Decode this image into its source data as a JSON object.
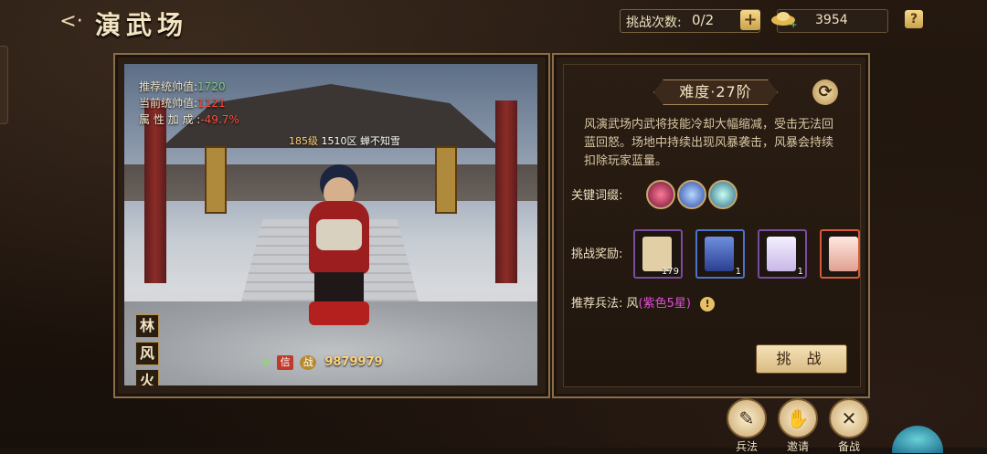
{
  "header": {
    "title": "演武场",
    "challenge_label": "挑战次数:",
    "challenge_count": "0/2",
    "gold": "3954",
    "help": "?"
  },
  "hero": {
    "recommended_label": "推荐统帅值:",
    "recommended_value": "1720",
    "current_label": "当前统帅值:",
    "current_value": "1121",
    "bonus_label": "属 性 加 成 :",
    "bonus_value": "-49.7%",
    "level": "185级",
    "server": "1510区",
    "player_name": "蝉不知雪",
    "power": "9879979",
    "badge_text": "信",
    "badge2_text": "战"
  },
  "side_tags": [
    "林",
    "风",
    "火"
  ],
  "panel": {
    "difficulty": "难度·27阶",
    "description": "风演武场内武将技能冷却大幅缩减，受击无法回蓝回怒。场地中持续出现风暴袭击，风暴会持续扣除玩家蓝量。",
    "keywords_label": "关键词缀:",
    "rewards_label": "挑战奖励:",
    "rewards": [
      {
        "count": "179",
        "color": "#b58cd6"
      },
      {
        "count": "1",
        "color": "#4b74c8"
      },
      {
        "count": "1",
        "color": "#a25ad4"
      },
      {
        "count": "",
        "color": "#d85a3a"
      }
    ],
    "recommend_label": "推荐兵法:",
    "recommend_value": "风",
    "recommend_detail": "(紫色5星)",
    "challenge_button": "挑 战"
  },
  "bottom": [
    {
      "label": "兵法",
      "icon": "scroll-icon"
    },
    {
      "label": "邀请",
      "icon": "handshake-icon"
    },
    {
      "label": "备战",
      "icon": "crossed-swords-icon"
    }
  ],
  "colors": {
    "accent_gold": "#d9bb82",
    "red_value": "#ff4d3a",
    "green_value": "#7fcf7f",
    "purple_text": "#e04fd7"
  }
}
